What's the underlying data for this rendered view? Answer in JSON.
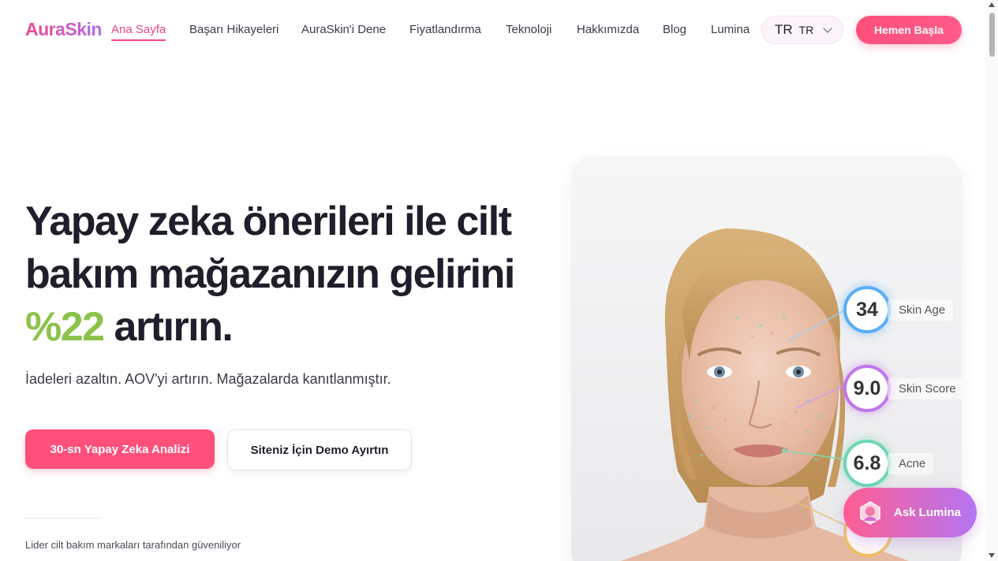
{
  "brand": {
    "logo": "AuraSkin"
  },
  "nav": {
    "links": [
      "Ana Sayfa",
      "Başarı Hikayeleri",
      "AuraSkin'i Dene",
      "Fiyatlandırma",
      "Teknoloji",
      "Hakkımızda",
      "Blog",
      "Lumina"
    ],
    "active": "Ana Sayfa",
    "language": {
      "code_display": "TR",
      "selected": "TR"
    },
    "cta": "Hemen Başla"
  },
  "hero": {
    "title_part1": "Yapay zeka önerileri ile cilt bakım mağazanızın gelirini ",
    "title_accent": "%22",
    "title_part2": " artırın.",
    "subtitle": "İadeleri azaltın. AOV'yi artırın. Mağazalarda kanıtlanmıştır.",
    "primary_button": "30-sn Yapay Zeka Analizi",
    "secondary_button": "Siteniz İçin Demo Ayırtın",
    "trusted_text": "Lider cilt bakım markaları tarafından güveniliyor"
  },
  "analysis": {
    "metrics": [
      {
        "value": "34",
        "label": "Skin Age",
        "color": "#5aaef5"
      },
      {
        "value": "9.0",
        "label": "Skin Score",
        "color": "#c077ee"
      },
      {
        "value": "6.8",
        "label": "Acne",
        "color": "#6fd6b4"
      }
    ]
  },
  "assistant": {
    "label": "Ask Lumina"
  },
  "colors": {
    "accent_pink": "#ff4f7b",
    "accent_green": "#8bc34a",
    "brand_gradient_start": "#f0468a",
    "brand_gradient_end": "#b06cf0"
  }
}
